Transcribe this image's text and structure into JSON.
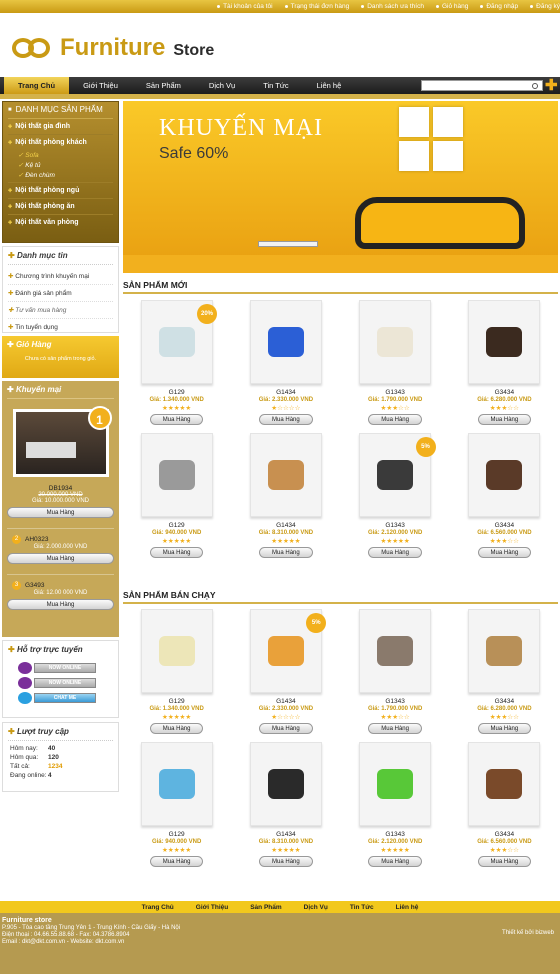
{
  "top_links": [
    "Tài khoản của tôi",
    "Trạng thái đơn hàng",
    "Danh sách ưa thích",
    "Giỏ hàng",
    "Đăng nhập",
    "Đăng ký"
  ],
  "logo": {
    "main": "Furniture",
    "sub": "Store"
  },
  "nav": [
    "Trang Chủ",
    "Giới Thiệu",
    "Sản Phẩm",
    "Dịch Vụ",
    "Tin Tức",
    "Liên hệ"
  ],
  "category": {
    "title": "DANH MỤC SẢN PHẨM",
    "items": [
      "Nội thất gia đình",
      "Nội thất phòng khách"
    ],
    "subs": [
      "Sofa",
      "Kệ tủ",
      "Đèn chùm"
    ],
    "items2": [
      "Nội thất phòng ngủ",
      "Nội thất phòng ăn",
      "Nội thất văn phòng"
    ]
  },
  "news": {
    "title": "Danh mục tin",
    "items": [
      "Chương trình khuyến mại",
      "Đánh giá sản phẩm",
      "Tư vấn mua hàng",
      "Tin tuyển dụng"
    ]
  },
  "cart": {
    "title": "Giỏ Hàng",
    "message": "Chưa có sản phẩm trong giỏ."
  },
  "promo": {
    "title": "Khuyến mại",
    "badge": "1",
    "code": "DB1934",
    "old_price": "20.000.000 VND",
    "new_price": "Giá: 10.000.000 VND",
    "button": "Mua Hàng",
    "items": [
      {
        "num": "2",
        "code": "AH0323",
        "price": "Giá: 2.000.000 VND",
        "button": "Mua Hàng"
      },
      {
        "num": "3",
        "code": "G3493",
        "price": "Giá: 12.00 000 VND",
        "button": "Mua Hàng"
      }
    ]
  },
  "support": {
    "title": "Hỗ trợ trực tuyến",
    "buttons": [
      "NOW ONLINE",
      "NOW ONLINE",
      "CHAT ME"
    ]
  },
  "stats": {
    "title": "Lượt truy cập",
    "rows": [
      {
        "label": "Hôm nay:",
        "value": "40"
      },
      {
        "label": "Hôm qua:",
        "value": "120"
      },
      {
        "label": "Tất cả:",
        "value": "1234"
      },
      {
        "label": "Đang online:",
        "value": "4"
      }
    ]
  },
  "banner": {
    "title": "KHUYẾN MẠI",
    "subtitle": "Safe 60%"
  },
  "sections": {
    "new": "SẢN PHẨM MỚI",
    "best": "SẢN PHẨM BÁN CHẠY"
  },
  "products_new": [
    {
      "code": "G129",
      "price": "Giá: 1.340.000 VND",
      "sale": "20%",
      "stars": "★★★★★",
      "color": "#cfe0e4"
    },
    {
      "code": "G1434",
      "price": "Giá: 2.330.000 VND",
      "sale": "",
      "stars": "★☆☆☆☆",
      "color": "#2b5fd6"
    },
    {
      "code": "G1343",
      "price": "Giá: 1.790.000 VND",
      "sale": "",
      "stars": "★★★☆☆",
      "color": "#ece6d6"
    },
    {
      "code": "G3434",
      "price": "Giá: 6.280.000 VND",
      "sale": "",
      "stars": "★★★☆☆",
      "color": "#3b2a1f"
    },
    {
      "code": "G129",
      "price": "Giá: 940.000 VND",
      "sale": "",
      "stars": "★★★★★",
      "color": "#9a9a9a"
    },
    {
      "code": "G1434",
      "price": "Giá: 8.310.000 VND",
      "sale": "",
      "stars": "★★★★★",
      "color": "#c89050"
    },
    {
      "code": "G1343",
      "price": "Giá: 2.120.000 VND",
      "sale": "5%",
      "stars": "★★★★★",
      "color": "#3a3a3a"
    },
    {
      "code": "G3434",
      "price": "Giá: 6.560.000 VND",
      "sale": "",
      "stars": "★★★☆☆",
      "color": "#5a3a28"
    }
  ],
  "products_best": [
    {
      "code": "G129",
      "price": "Giá: 1.340.000 VND",
      "sale": "",
      "stars": "★★★★★",
      "color": "#ede6b8"
    },
    {
      "code": "G1434",
      "price": "Giá: 2.330.000 VND",
      "sale": "5%",
      "stars": "★☆☆☆☆",
      "color": "#e9a13a"
    },
    {
      "code": "G1343",
      "price": "Giá: 1.790.000 VND",
      "sale": "",
      "stars": "★★★☆☆",
      "color": "#8a7a6c"
    },
    {
      "code": "G3434",
      "price": "Giá: 6.280.000 VND",
      "sale": "",
      "stars": "★★★☆☆",
      "color": "#b89058"
    },
    {
      "code": "G129",
      "price": "Giá: 940.000 VND",
      "sale": "",
      "stars": "★★★★★",
      "color": "#5eb4e0"
    },
    {
      "code": "G1434",
      "price": "Giá: 8.310.000 VND",
      "sale": "",
      "stars": "★★★★★",
      "color": "#2a2a2a"
    },
    {
      "code": "G1343",
      "price": "Giá: 2.120.000 VND",
      "sale": "",
      "stars": "★★★★★",
      "color": "#58c838"
    },
    {
      "code": "G3434",
      "price": "Giá: 6.560.000 VND",
      "sale": "",
      "stars": "★★★☆☆",
      "color": "#7a4a2a"
    }
  ],
  "buy_label": "Mua Hàng",
  "footer_nav": [
    "Trang Chủ",
    "Giới Thiệu",
    "Sản Phẩm",
    "Dịch Vụ",
    "Tin Tức",
    "Liên hệ"
  ],
  "footer": {
    "name": "Furniture store",
    "lines": [
      "P.905 - Tòa cao tầng Trung Yên 1 - Trung Kính - Cầu Giấy - Hà Nội",
      "Điện thoại : 04.66.55.88.68 - Fax: 04.3786.8904",
      "Email : dkt@dkt.com.vn - Website: dkt.com.vn"
    ],
    "credit": "Thiết kế bởi bizweb"
  }
}
